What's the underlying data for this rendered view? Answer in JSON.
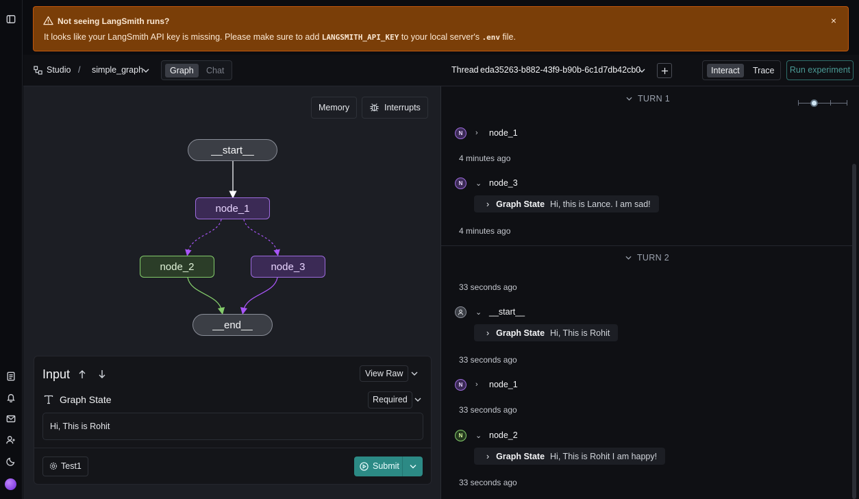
{
  "banner": {
    "title": "Not seeing LangSmith runs?",
    "message_pre": "It looks like your LangSmith API key is missing. Please make sure to add ",
    "message_code": "LANGSMITH_API_KEY",
    "message_mid": " to your local server's ",
    "message_code2": ".env",
    "message_post": " file.",
    "close": "×"
  },
  "left": {
    "breadcrumb": {
      "root": "Studio",
      "sep": "/",
      "graph": "simple_graph"
    },
    "view_toggle": {
      "graph": "Graph",
      "chat": "Chat"
    },
    "memory_button": "Memory",
    "interrupts_button": "Interrupts",
    "nodes": {
      "start": "__start__",
      "node1": "node_1",
      "node2": "node_2",
      "node3": "node_3",
      "end": "__end__"
    },
    "input": {
      "title": "Input",
      "view_raw": "View Raw",
      "field_label": "Graph State",
      "required": "Required",
      "value": "Hi, This is Rohit",
      "config_button": "Test1",
      "submit": "Submit"
    }
  },
  "right": {
    "thread_label": "Thread",
    "thread_id": "eda35263-b882-43f9-b90b-6c1d7db42cb0",
    "mode": {
      "interact": "Interact",
      "trace": "Trace"
    },
    "run_experiment": "Run experiment",
    "slider_level": 0.33,
    "turns": [
      {
        "label": "TURN 1",
        "entries": [
          {
            "badge": "N",
            "name": "node_1",
            "expanded": false,
            "time": "4 minutes ago"
          },
          {
            "badge": "N",
            "name": "node_3",
            "expanded": true,
            "state_key": "Graph State",
            "state_value": "Hi, this is Lance. I am sad!",
            "time": "4 minutes ago"
          }
        ]
      },
      {
        "label": "TURN 2",
        "first_time": "33 seconds ago",
        "entries": [
          {
            "badge": "user",
            "name": "__start__",
            "expanded": true,
            "state_key": "Graph State",
            "state_value": "Hi, This is Rohit",
            "time": "33 seconds ago"
          },
          {
            "badge": "N",
            "name": "node_1",
            "expanded": false,
            "time": "33 seconds ago"
          },
          {
            "badge": "N",
            "name": "node_2",
            "expanded": true,
            "state_key": "Graph State",
            "state_value": "Hi, This is Rohit I am happy!",
            "time": "33 seconds ago"
          }
        ]
      }
    ]
  },
  "colors": {
    "banner_bg": "#7a3e08",
    "node_purple": "#9d6bde",
    "node_green": "#84cc6b",
    "submit_bg": "#2c8a85"
  }
}
